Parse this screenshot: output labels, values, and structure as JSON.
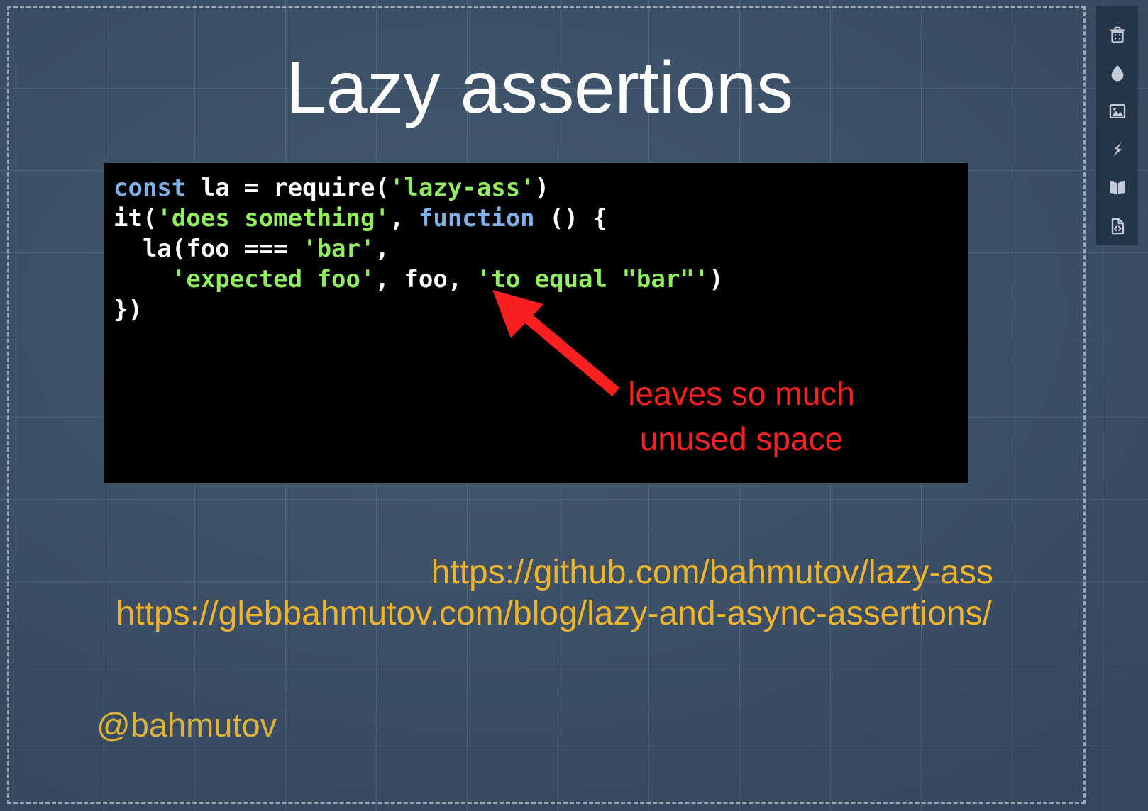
{
  "slide": {
    "title": "Lazy assertions",
    "background_color": "#3c5068",
    "grid_line_color": "rgba(255,255,255,0.10)"
  },
  "code_block": {
    "background_color": "#000000",
    "language": "javascript",
    "colors": {
      "keyword": "#7fb1e8",
      "string": "#90ee5f",
      "plain": "#ffffff"
    },
    "lines": [
      "const la = require('lazy-ass')",
      "it('does something', function () {",
      "  la(foo === 'bar',",
      "    'expected foo', foo, 'to equal \"bar\"')",
      "})"
    ],
    "full_text": "const la = require('lazy-ass')\nit('does something', function () {\n  la(foo === 'bar',\n    'expected foo', foo, 'to equal \"bar\"')\n})"
  },
  "annotation": {
    "color": "#fa2020",
    "line_1": "leaves so much",
    "line_2": "unused space",
    "text": "leaves so much unused space"
  },
  "links": {
    "color": "#f0b429",
    "repo": "https://github.com/bahmutov/lazy-ass",
    "blog": "https://glebbahmutov.com/blog/lazy-and-async-assertions/"
  },
  "handle": {
    "text": "@bahmutov",
    "color": "#ddb437"
  },
  "tool_sidebar": {
    "background_color": "#253548",
    "icon_color": "#c3ccd6",
    "items": [
      {
        "name": "trash-icon",
        "label": "Trash"
      },
      {
        "name": "droplet-icon",
        "label": "Droplet"
      },
      {
        "name": "image-icon",
        "label": "Image"
      },
      {
        "name": "lightning-bolt-icon",
        "label": "Lightning"
      },
      {
        "name": "open-book-icon",
        "label": "Book"
      },
      {
        "name": "code-file-icon",
        "label": "Code file"
      }
    ]
  }
}
